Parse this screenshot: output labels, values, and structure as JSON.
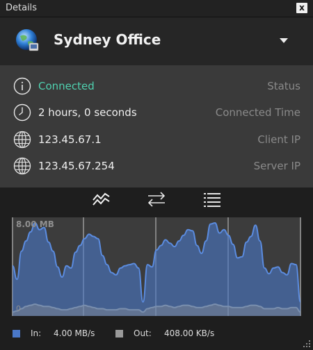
{
  "window": {
    "title": "Details",
    "close_label": "x"
  },
  "header": {
    "connection_name": "Sydney Office"
  },
  "details": [
    {
      "icon": "info-icon",
      "value": "Connected",
      "label": "Status"
    },
    {
      "icon": "clock-icon",
      "value": "2 hours, 0 seconds",
      "label": "Connected Time"
    },
    {
      "icon": "globe-icon",
      "value": "123.45.67.1",
      "label": "Client IP"
    },
    {
      "icon": "globe-icon",
      "value": "123.45.67.254",
      "label": "Server IP"
    }
  ],
  "tabs": [
    {
      "name": "graph-tab",
      "icon": "chart-line-icon",
      "active": true
    },
    {
      "name": "transfer-tab",
      "icon": "arrows-swap-icon",
      "active": false
    },
    {
      "name": "list-tab",
      "icon": "list-icon",
      "active": false
    }
  ],
  "chart_data": {
    "type": "area",
    "ymax_label": "8.00 MB",
    "ymin_label": "0",
    "ylim": [
      0,
      8
    ],
    "series": [
      {
        "name": "In",
        "color": "#4a78c8",
        "values": [
          4.2,
          3.0,
          5.5,
          6.4,
          7.2,
          8.0,
          7.4,
          7.6,
          6.3,
          5.5,
          4.1,
          3.2,
          4.2,
          4.0,
          5.4,
          6.0,
          6.6,
          7.0,
          6.8,
          6.6,
          5.1,
          4.3,
          3.6,
          3.4,
          4.0,
          4.2,
          4.3,
          4.4,
          4.0,
          1.0,
          4.3,
          4.1,
          5.6,
          6.0,
          6.5,
          6.2,
          5.9,
          6.4,
          6.9,
          7.4,
          7.3,
          6.0,
          5.3,
          6.4,
          7.9,
          8.0,
          7.1,
          7.4,
          6.9,
          6.1,
          4.9,
          5.0,
          6.3,
          6.8,
          7.8,
          6.4,
          4.0,
          3.5,
          4.0,
          4.1,
          3.6,
          3.4,
          4.4,
          4.3,
          1.0
        ]
      },
      {
        "name": "Out",
        "color": "#999999",
        "values": [
          0.1,
          0.2,
          0.4,
          0.6,
          0.7,
          0.8,
          0.7,
          0.6,
          0.6,
          0.5,
          0.4,
          0.3,
          0.3,
          0.4,
          0.5,
          0.6,
          0.7,
          0.6,
          0.5,
          0.4,
          0.4,
          0.3,
          0.3,
          0.3,
          0.4,
          0.4,
          0.3,
          0.3,
          0.3,
          0.1,
          0.4,
          0.5,
          0.6,
          0.6,
          0.7,
          0.6,
          0.5,
          0.6,
          0.7,
          0.7,
          0.6,
          0.5,
          0.5,
          0.6,
          0.7,
          0.8,
          0.7,
          0.6,
          0.6,
          0.5,
          0.5,
          0.5,
          0.6,
          0.7,
          0.7,
          0.6,
          0.4,
          0.4,
          0.4,
          0.5,
          0.4,
          0.4,
          0.5,
          0.5,
          0.1
        ]
      }
    ]
  },
  "legend": {
    "in_label": "In:",
    "in_value": "4.00 MB/s",
    "in_color": "#4a78c8",
    "out_label": "Out:",
    "out_value": "408.00 KB/s",
    "out_color": "#9a9a9a"
  }
}
